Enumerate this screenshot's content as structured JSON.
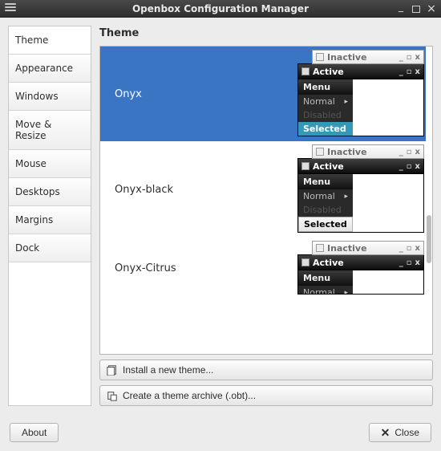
{
  "window": {
    "title": "Openbox Configuration Manager"
  },
  "sidebar": {
    "items": [
      {
        "label": "Theme"
      },
      {
        "label": "Appearance"
      },
      {
        "label": "Windows"
      },
      {
        "label": "Move & Resize"
      },
      {
        "label": "Mouse"
      },
      {
        "label": "Desktops"
      },
      {
        "label": "Margins"
      },
      {
        "label": "Dock"
      }
    ],
    "active_index": 0
  },
  "section_title": "Theme",
  "themes": [
    {
      "name": "Onyx",
      "selected": true,
      "selected_style": "onyx"
    },
    {
      "name": "Onyx-black",
      "selected": false,
      "selected_style": "black"
    },
    {
      "name": "Onyx-Citrus",
      "selected": false,
      "selected_style": "partial"
    }
  ],
  "preview": {
    "inactive_label": "Inactive",
    "active_label": "Active",
    "menu_title": "Menu",
    "menu_normal": "Normal",
    "menu_disabled": "Disabled",
    "menu_selected": "Selected"
  },
  "actions": {
    "install": "Install a new theme...",
    "archive": "Create a theme archive (.obt)..."
  },
  "footer": {
    "about": "About",
    "close": "Close"
  }
}
